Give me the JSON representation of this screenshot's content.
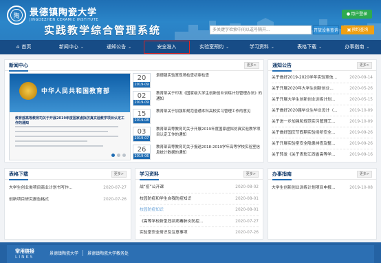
{
  "header": {
    "logo_cn": "景德镇陶瓷大学",
    "logo_en": "JINGDEZHEN CERAMIC INSTITUTE",
    "logo_glyph": "陶",
    "system_title": "实践教学综合管理系统",
    "login_label": "用户登录",
    "search_placeholder": "多关键字检索中间以逗号隔开...",
    "search_button": "开放设备查询",
    "feedback_button": "预约查询"
  },
  "nav": {
    "items": [
      {
        "label": "首页",
        "has_icon": true,
        "chevron": false
      },
      {
        "label": "新闻中心",
        "chevron": true
      },
      {
        "label": "通知公告",
        "chevron": true
      },
      {
        "label": "安全准入",
        "chevron": false,
        "highlighted": true
      },
      {
        "label": "实验室预约",
        "chevron": true
      },
      {
        "label": "学习资料",
        "chevron": true
      },
      {
        "label": "表格下载",
        "chevron": true
      },
      {
        "label": "办事指南",
        "chevron": true
      }
    ]
  },
  "news": {
    "title": "新闻中心",
    "more": "更多>",
    "slide": {
      "banner_text": "中华人民共和国教育部",
      "doc_title": "教育部高等教育司关于开展2019年度国家虚拟仿真实验教学项目认定工作的通知"
    },
    "items": [
      {
        "day": "20",
        "ym": "2019-09",
        "text": "景德镇实验室现场检查初审检查"
      },
      {
        "day": "02",
        "ym": "2019-09",
        "text": "教育部关于印发《国家级大学生创新创业训练计划管理办法》的通知"
      },
      {
        "day": "15",
        "ym": "2019-08",
        "text": "教育部关于加强和规范普通本科高校实习管理工作的意见"
      },
      {
        "day": "03",
        "ym": "2019-07",
        "text": "教育部高等教育司关于开展2019年度国家虚拟仿真实验教学项目认定工作的通知"
      },
      {
        "day": "26",
        "ym": "2019-06",
        "text": "教育部高等教育司关于报送2018-2019学年高等学校实验室信息统计数据的通知"
      }
    ]
  },
  "notices": {
    "title": "通知公告",
    "more": "更多>",
    "items": [
      {
        "text": "关于做好2019-2020学年实验室信...",
        "date": "2020-09-14"
      },
      {
        "text": "关于开展2020年大学生创新创业...",
        "date": "2020-05-26"
      },
      {
        "text": "关于开展大学生创新创业训练计划...",
        "date": "2020-05-15"
      },
      {
        "text": "关于做好2020届毕业生毕业设计（...",
        "date": "2019-10-09"
      },
      {
        "text": "关于进一步加强和规范实习管理工...",
        "date": "2019-10-09"
      },
      {
        "text": "关于做好国庆节假期实验场所安全...",
        "date": "2019-09-26"
      },
      {
        "text": "关于开展实验室安全隐患排查及整...",
        "date": "2019-09-26"
      },
      {
        "text": "关于转发《关于表彰江西省高等学...",
        "date": "2019-09-16"
      }
    ]
  },
  "forms": {
    "title": "表格下载",
    "more": "更多>",
    "items": [
      {
        "text": "大学生创业类项目商业计划书写作...",
        "date": "2020-07-27"
      },
      {
        "text": "创新项目研究报告格式",
        "date": "2020-07-26"
      }
    ]
  },
  "materials": {
    "title": "学习资料",
    "more": "更多>",
    "items": [
      {
        "text": "战“疫”公开课",
        "date": "2020-08-02",
        "link": false
      },
      {
        "text": "校园防疫和学生自我防疫知识",
        "date": "2020-08-01",
        "link": false
      },
      {
        "text": "校园防疫知识",
        "date": "2020-08-01",
        "link": true
      },
      {
        "text": "《高等学校新型冠状病毒肺炎防控...",
        "date": "2020-07-27",
        "link": false
      },
      {
        "text": "实验室安全常识及注意事项",
        "date": "2020-07-26",
        "link": false
      }
    ]
  },
  "guide": {
    "title": "办事指南",
    "more": "更多>",
    "items": [
      {
        "text": "大学生创新创业训练计划项目申报...",
        "date": "2019-10-08"
      }
    ]
  },
  "footer": {
    "label": "常用链接",
    "label_en": "LINKS",
    "links": [
      "景德镇陶瓷大学",
      "景德镇陶瓷大学教务处"
    ]
  },
  "colors": {
    "header_blue": "#2b86c9",
    "nav_dark": "#174c86",
    "accent_blue": "#1e6cb3",
    "highlight_red": "#e32420",
    "login_green": "#2eaa4f",
    "feedback_orange": "#f0a013"
  }
}
